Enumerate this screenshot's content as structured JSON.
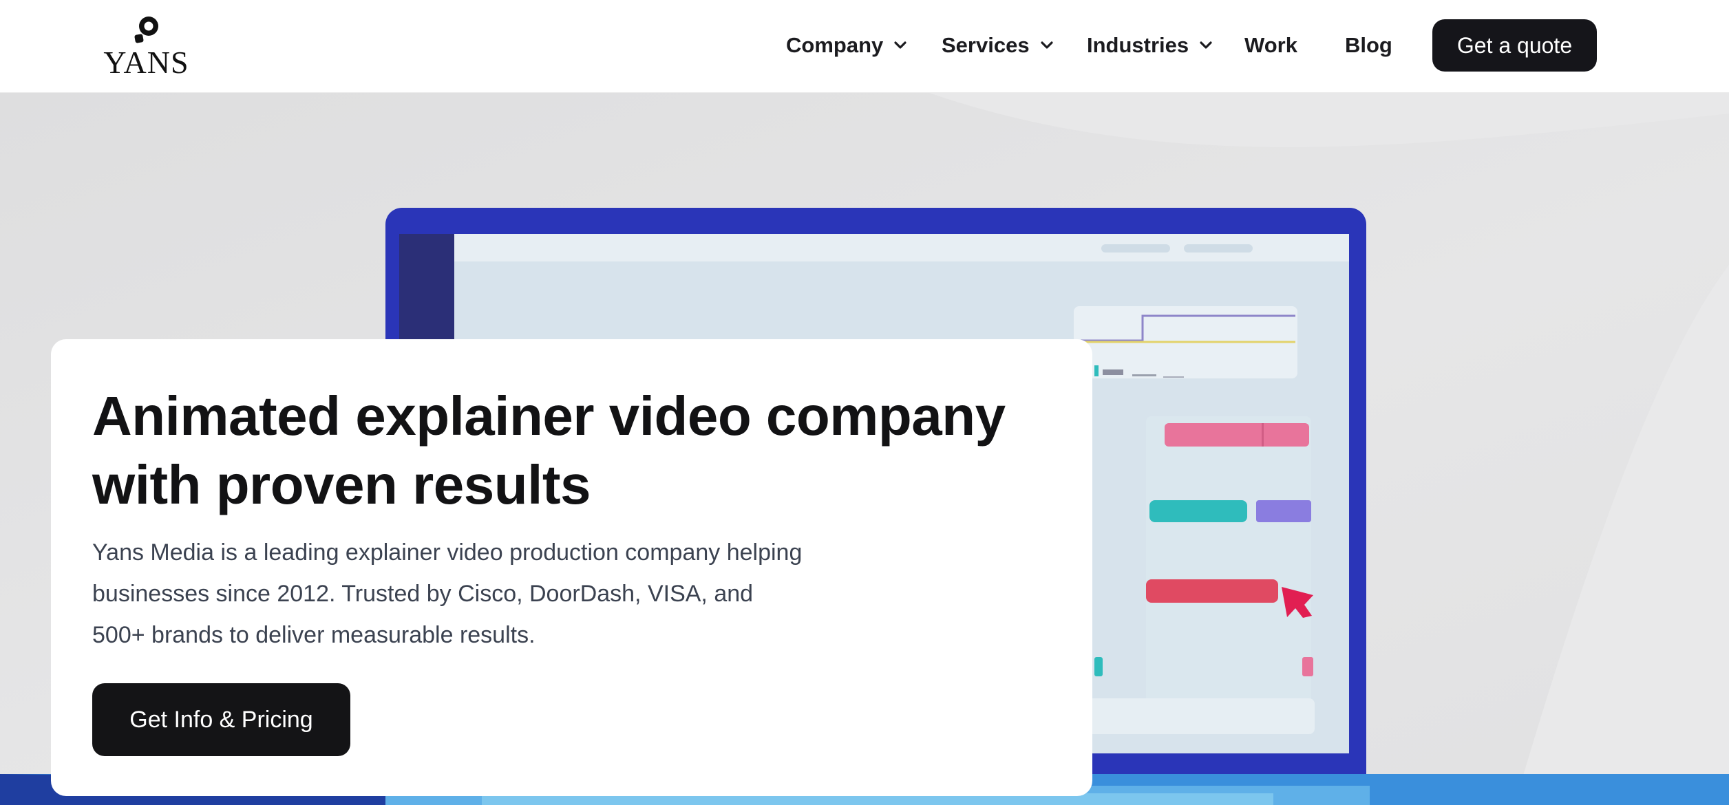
{
  "brand": {
    "name": "YANS"
  },
  "nav": {
    "items": [
      {
        "label": "Company",
        "has_dropdown": true
      },
      {
        "label": "Services",
        "has_dropdown": true
      },
      {
        "label": "Industries",
        "has_dropdown": true
      },
      {
        "label": "Work",
        "has_dropdown": false
      },
      {
        "label": "Blog",
        "has_dropdown": false
      }
    ],
    "cta_label": "Get a quote"
  },
  "hero": {
    "headline_line1": "Animated explainer video company",
    "headline_line2": "with proven results",
    "description_lines": [
      "Yans Media is a leading explainer video production company helping",
      "businesses since 2012. Trusted by Cisco, DoorDash, VISA, and",
      "500+ brands to deliver measurable results."
    ],
    "cta_label": "Get Info & Pricing"
  },
  "icons": {
    "logo": "magnifier-logo-icon",
    "dropdown": "chevron-down-icon",
    "illustration": "laptop-illustration",
    "cursor": "pointer-cursor-icon"
  },
  "colors": {
    "dark_button": "#15151a",
    "laptop_frame": "#2a35b8",
    "screen": "#dbe6ee",
    "pink": "#e8749b",
    "teal": "#2fbcbc",
    "purple": "#8a7de0",
    "red": "#e04a62"
  }
}
